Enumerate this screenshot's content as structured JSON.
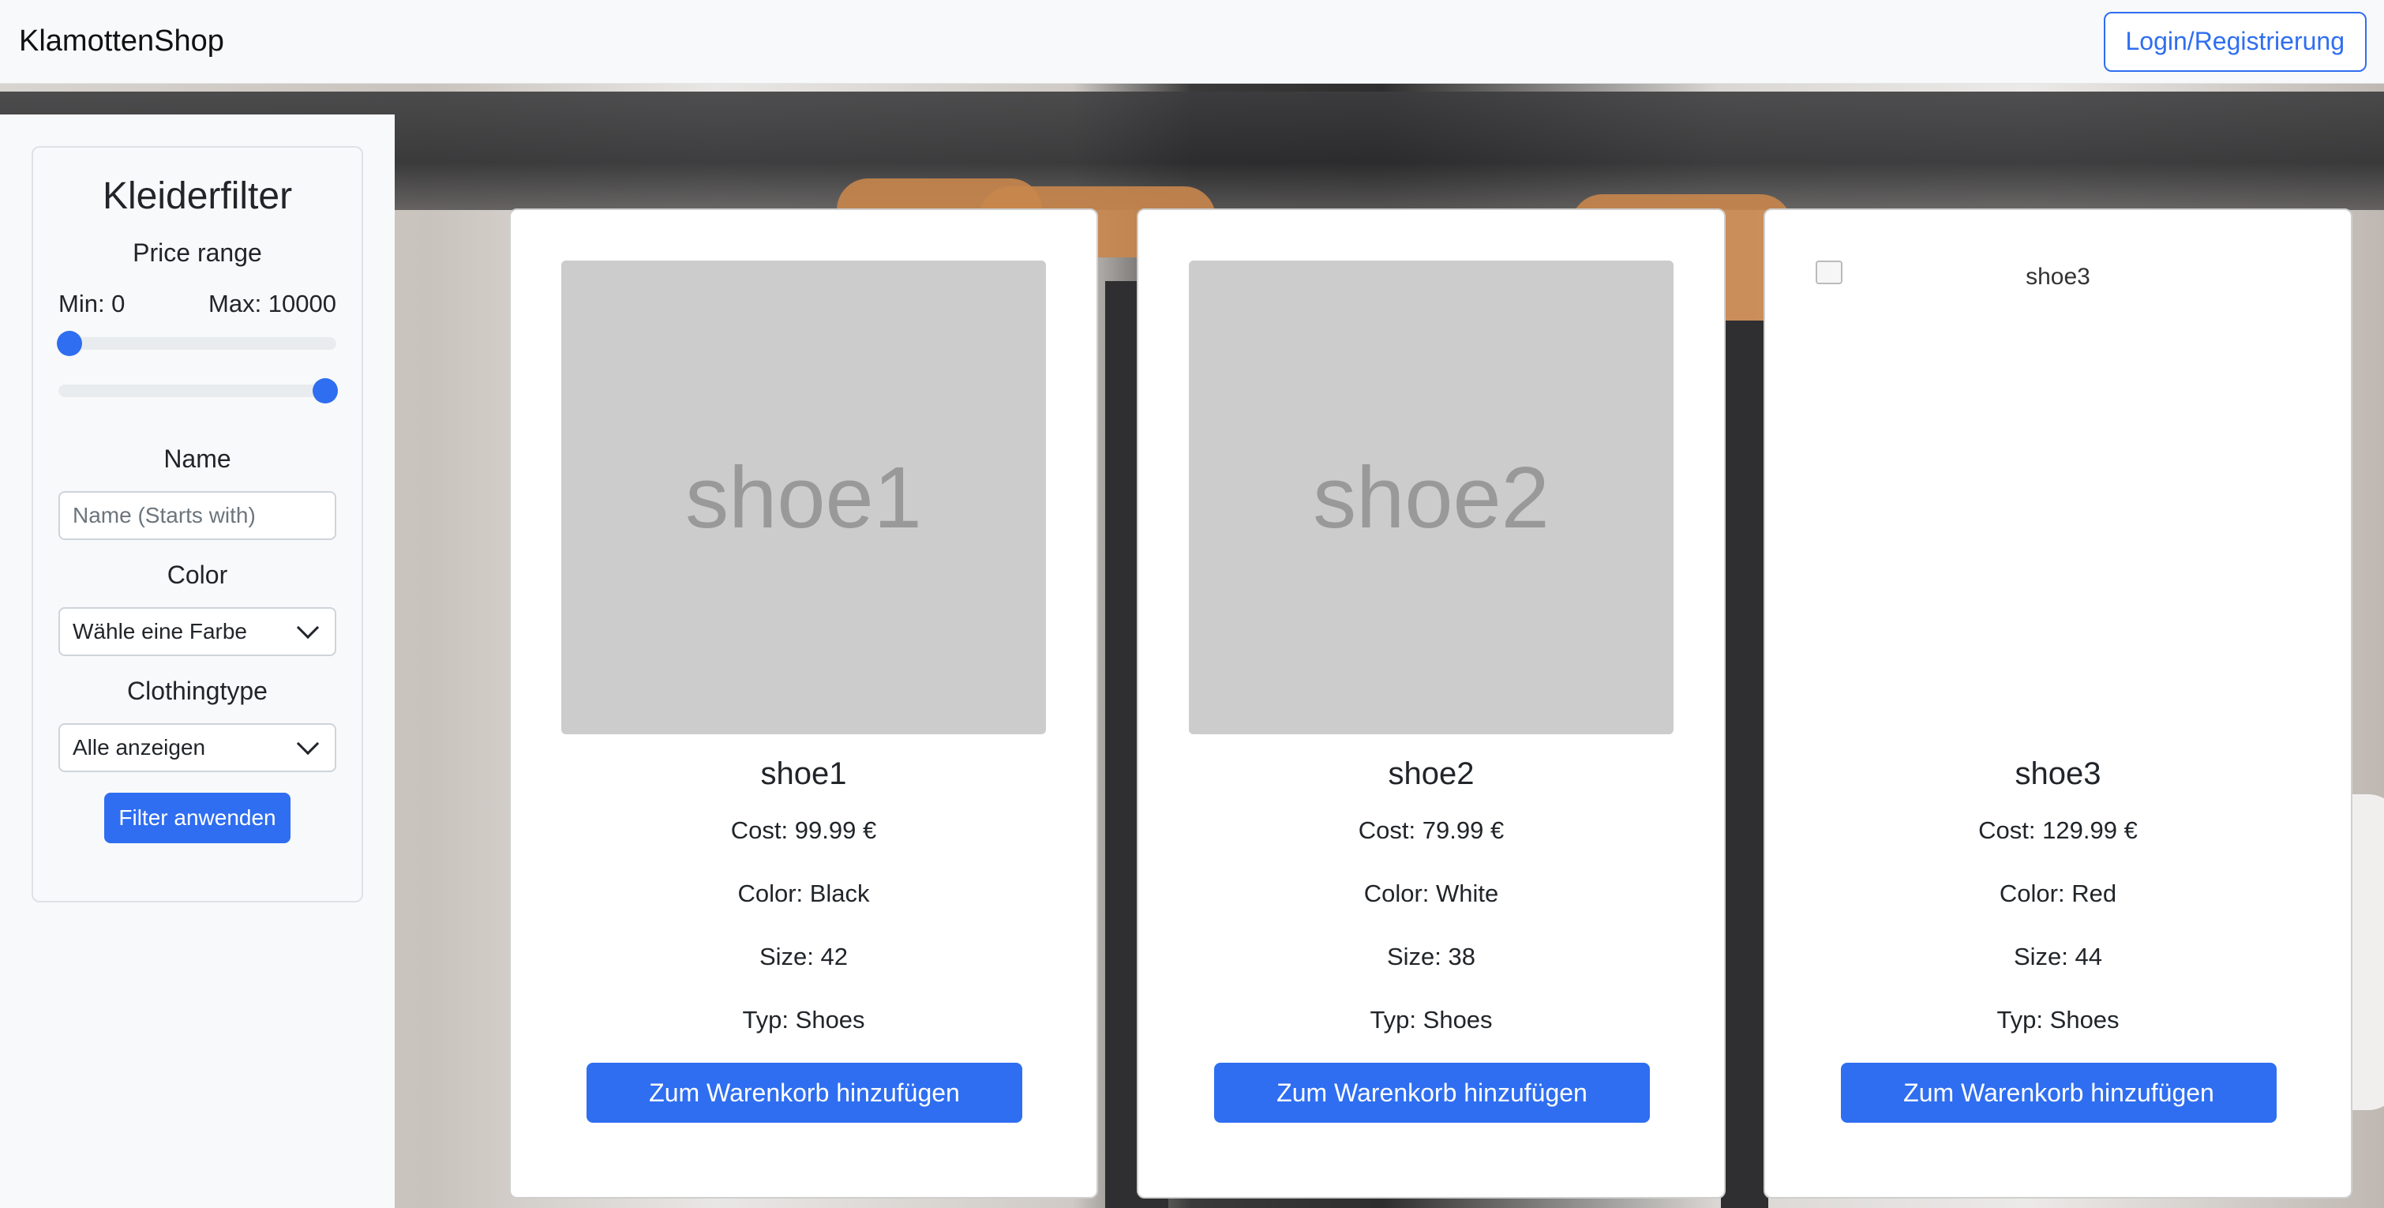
{
  "navbar": {
    "brand": "KlamottenShop",
    "login_label": "Login/Registrierung"
  },
  "sidebar": {
    "title": "Kleiderfilter",
    "price": {
      "label": "Price range",
      "min_text": "Min: 0",
      "max_text": "Max: 10000",
      "min_value": 0,
      "max_value": 10000
    },
    "name": {
      "label": "Name",
      "placeholder": "Name (Starts with)",
      "value": ""
    },
    "color": {
      "label": "Color",
      "selected": "Wähle eine Farbe"
    },
    "clothingtype": {
      "label": "Clothingtype",
      "selected": "Alle anzeigen"
    },
    "apply_label": "Filter anwenden"
  },
  "products": [
    {
      "image_text": "shoe1",
      "name": "shoe1",
      "cost": "Cost: 99.99 €",
      "color": "Color: Black",
      "size": "Size: 42",
      "typ": "Typ: Shoes",
      "button": "Zum Warenkorb hinzufügen"
    },
    {
      "image_text": "shoe2",
      "name": "shoe2",
      "cost": "Cost: 79.99 €",
      "color": "Color: White",
      "size": "Size: 38",
      "typ": "Typ: Shoes",
      "button": "Zum Warenkorb hinzufügen"
    },
    {
      "image_alt": "shoe3",
      "name": "shoe3",
      "cost": "Cost: 129.99 €",
      "color": "Color: Red",
      "size": "Size: 44",
      "typ": "Typ: Shoes",
      "button": "Zum Warenkorb hinzufügen"
    }
  ],
  "colors": {
    "accent": "#2f6ef0",
    "placeholder_image": "#cccccc"
  }
}
